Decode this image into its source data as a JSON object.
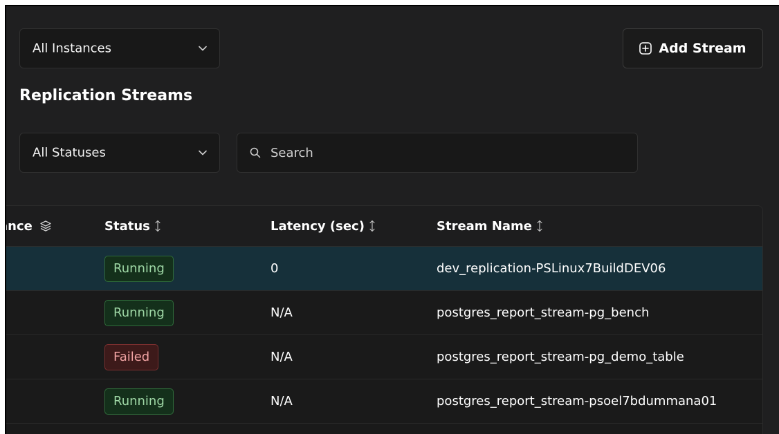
{
  "filters": {
    "instances": {
      "label": "All Instances"
    },
    "statuses": {
      "label": "All Statuses"
    },
    "search": {
      "placeholder": "Search"
    }
  },
  "toolbar": {
    "add_stream_label": "Add Stream"
  },
  "section": {
    "title": "Replication Streams"
  },
  "table": {
    "headers": {
      "instance": "ance",
      "status": "Status",
      "latency": "Latency (sec)",
      "stream_name": "Stream Name"
    },
    "rows": [
      {
        "status": "Running",
        "latency": "0",
        "stream_name": "dev_replication-PSLinux7BuildDEV06"
      },
      {
        "status": "Running",
        "latency": "N/A",
        "stream_name": "postgres_report_stream-pg_bench"
      },
      {
        "status": "Failed",
        "latency": "N/A",
        "stream_name": "postgres_report_stream-pg_demo_table"
      },
      {
        "status": "Running",
        "latency": "N/A",
        "stream_name": "postgres_report_stream-psoel7bdummana01"
      }
    ]
  },
  "colors": {
    "running_badge_bg": "#14301b",
    "running_badge_text": "#9fd8a6",
    "failed_badge_bg": "#3d1a1a",
    "failed_badge_text": "#f2a4a4",
    "selected_row_bg": "#16303a"
  },
  "icons": {
    "select_chevron": "chevron-down-icon",
    "search": "search-icon",
    "add": "plus-circle-icon",
    "sort": "sort-icon",
    "layers": "layers-icon"
  }
}
